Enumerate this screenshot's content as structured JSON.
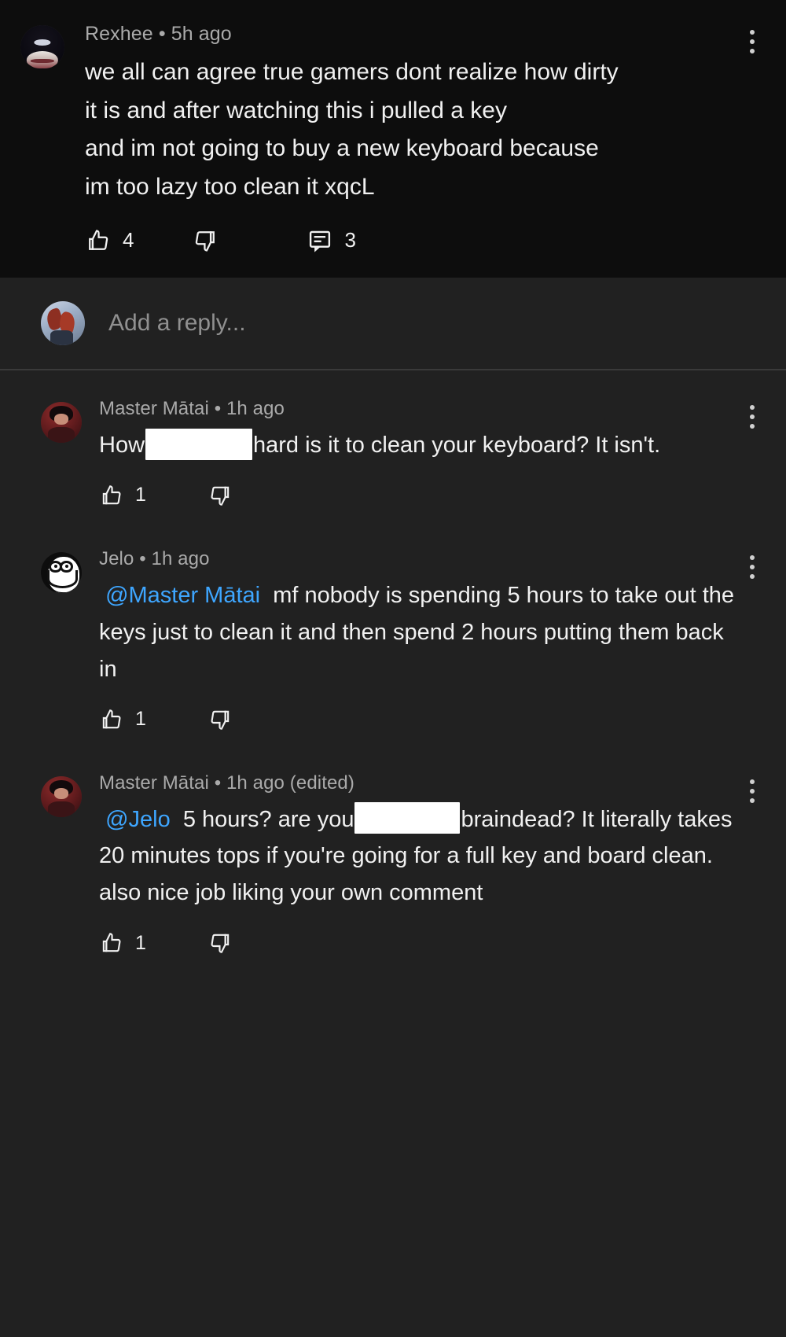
{
  "theme": {
    "parent_background": "#0d0d0d",
    "replies_background": "#212121",
    "text_primary": "#f1f1f1",
    "text_secondary": "#aaaaaa",
    "mention_color": "#3ea6ff",
    "placeholder_color": "#909090",
    "redaction_color": "#ffffff"
  },
  "parent_comment": {
    "author": "Rexhee",
    "separator": "•",
    "timestamp": "5h ago",
    "avatar": "rexhee-avatar",
    "text_lines": [
      "we all can agree true gamers dont realize how dirty",
      "it is and after watching this i pulled a key",
      "and im not going to buy a new keyboard because",
      "im too lazy too clean it xqcL"
    ],
    "full_text": "we all can agree true gamers dont realize how dirty it is and after watching this i pulled a key and im not going to buy a new keyboard because im too lazy too clean it xqcL",
    "like_count": "4",
    "dislike_count": "",
    "reply_count": "3",
    "menu_icon": "kebab-menu-icon",
    "like_icon": "thumbs-up-icon",
    "dislike_icon": "thumbs-down-icon",
    "replies_icon": "comment-bubble-icon"
  },
  "add_reply": {
    "placeholder": "Add a reply...",
    "avatar": "current-user-avatar"
  },
  "replies": [
    {
      "author": "Master Mātai",
      "separator": "•",
      "timestamp": "1h ago",
      "edited": "",
      "avatar": "master-matai-avatar",
      "mention": "",
      "segments": [
        {
          "type": "text",
          "value": "How"
        },
        {
          "type": "redaction",
          "value": ""
        },
        {
          "type": "text",
          "value": "hard is it to clean your keyboard? It isn't."
        }
      ],
      "full_text": "How [redacted] hard is it to clean your keyboard? It isn't.",
      "like_count": "1",
      "dislike_count": "",
      "menu_icon": "kebab-menu-icon",
      "like_icon": "thumbs-up-icon",
      "dislike_icon": "thumbs-down-icon"
    },
    {
      "author": "Jelo",
      "separator": "•",
      "timestamp": "1h ago",
      "edited": "",
      "avatar": "jelo-avatar",
      "mention": "@Master Mātai",
      "segments": [
        {
          "type": "mention",
          "value": "@Master Mātai"
        },
        {
          "type": "text",
          "value": "mf nobody is spending 5 hours to take out the keys just to clean it and then spend 2 hours putting them back in"
        }
      ],
      "full_text": "@Master Mātai mf nobody is spending 5 hours to take out the keys just to clean it and then spend 2 hours putting them back in",
      "like_count": "1",
      "dislike_count": "",
      "menu_icon": "kebab-menu-icon",
      "like_icon": "thumbs-up-icon",
      "dislike_icon": "thumbs-down-icon"
    },
    {
      "author": "Master Mātai",
      "separator": "•",
      "timestamp": "1h ago",
      "edited": "(edited)",
      "avatar": "master-matai-avatar",
      "mention": "@Jelo",
      "segments": [
        {
          "type": "mention",
          "value": "@Jelo"
        },
        {
          "type": "text",
          "value": "5 hours? are you"
        },
        {
          "type": "redaction",
          "value": ""
        },
        {
          "type": "text",
          "value": "braindead? It literally takes 20 minutes tops if you're going for a full key and board clean. also nice job liking your own comment"
        }
      ],
      "full_text": "@Jelo 5 hours? are you [redacted] braindead? It literally takes 20 minutes tops if you're going for a full key and board clean. also nice job liking your own comment",
      "like_count": "1",
      "dislike_count": "",
      "menu_icon": "kebab-menu-icon",
      "like_icon": "thumbs-up-icon",
      "dislike_icon": "thumbs-down-icon"
    }
  ]
}
